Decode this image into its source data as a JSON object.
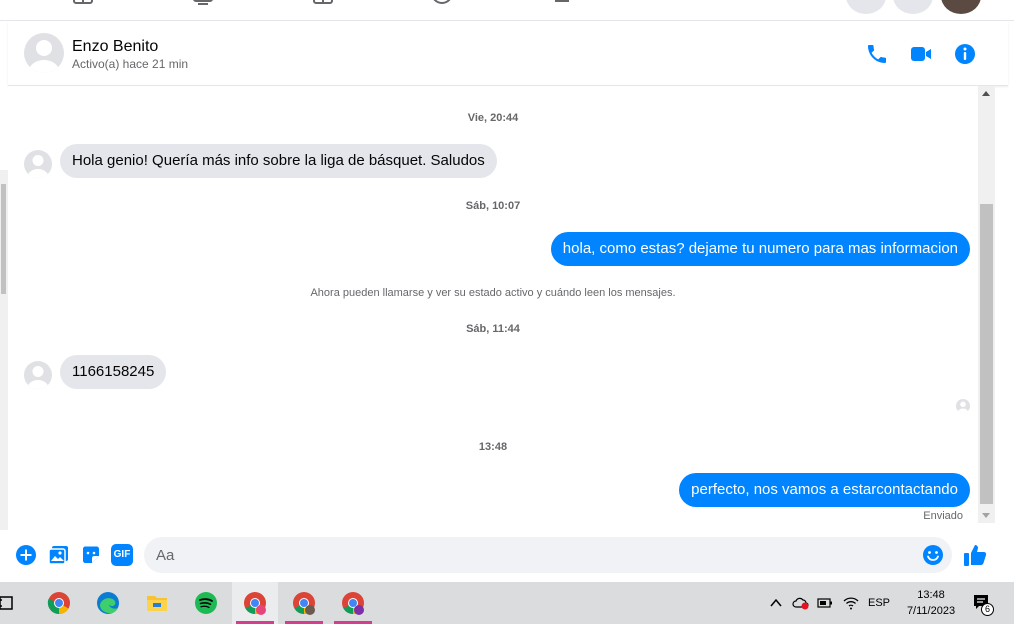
{
  "contact": {
    "name": "Enzo Benito",
    "status": "Activo(a) hace 21 min"
  },
  "messages": {
    "ts1": "Vie, 20:44",
    "msg1": "Hola genio! Quería más info sobre la liga de básquet. Saludos",
    "ts2": "Sáb, 10:07",
    "msg2": "hola, como estas? dejame tu numero para mas informacion",
    "notice": "Ahora pueden llamarse y ver su estado activo y cuándo leen los mensajes.",
    "ts3": "Sáb, 11:44",
    "msg3": "1166158245",
    "ts4": "13:48",
    "msg4": "perfecto, nos vamos a estarcontactando",
    "sent_label": "Enviado"
  },
  "composer": {
    "placeholder": "Aa",
    "gif_label": "GIF"
  },
  "taskbar": {
    "language": "ESP",
    "time": "13:48",
    "date": "7/11/2023",
    "notification_count": "6"
  },
  "colors": {
    "accent": "#0084ff",
    "incoming_bubble": "#e4e6eb",
    "taskbar": "#dadcdd",
    "active_indicator": "#d43f8d"
  }
}
